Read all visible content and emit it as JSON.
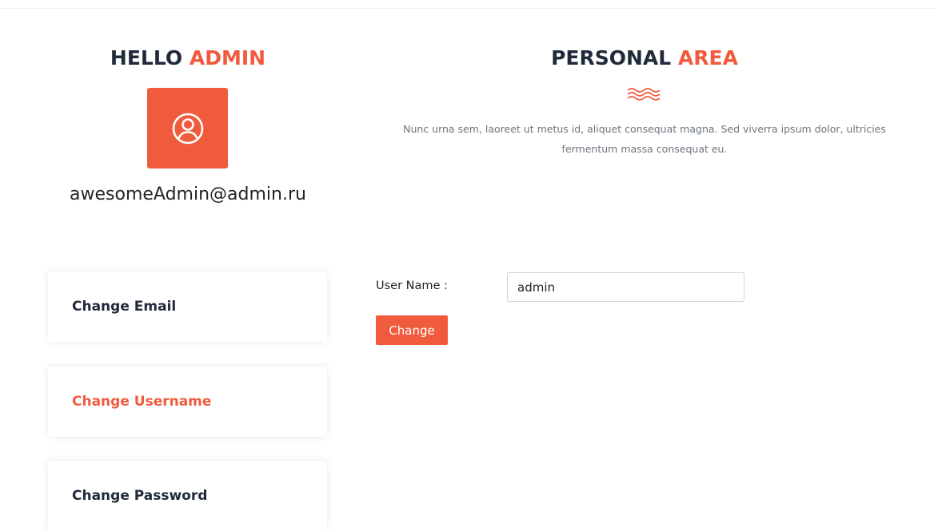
{
  "profile": {
    "greeting_prefix": "HELLO",
    "greeting_name": "ADMIN",
    "email": "awesomeAdmin@admin.ru",
    "avatar_icon": "user-circle-icon"
  },
  "personal_area": {
    "title_prefix": "PERSONAL",
    "title_accent": "AREA",
    "divider_icon": "wave-icon",
    "description": "Nunc urna sem, laoreet ut metus id, aliquet consequat magna. Sed viverra ipsum dolor, ultricies fermentum massa consequat eu."
  },
  "menu": {
    "items": [
      {
        "label": "Change Email",
        "active": false
      },
      {
        "label": "Change Username",
        "active": true
      },
      {
        "label": "Change Password",
        "active": false
      }
    ]
  },
  "form": {
    "username_label": "User Name :",
    "username_value": "admin",
    "submit_label": "Change"
  },
  "colors": {
    "accent": "#f05a3d",
    "heading": "#1f2a3a",
    "muted_text": "#6c757d"
  }
}
